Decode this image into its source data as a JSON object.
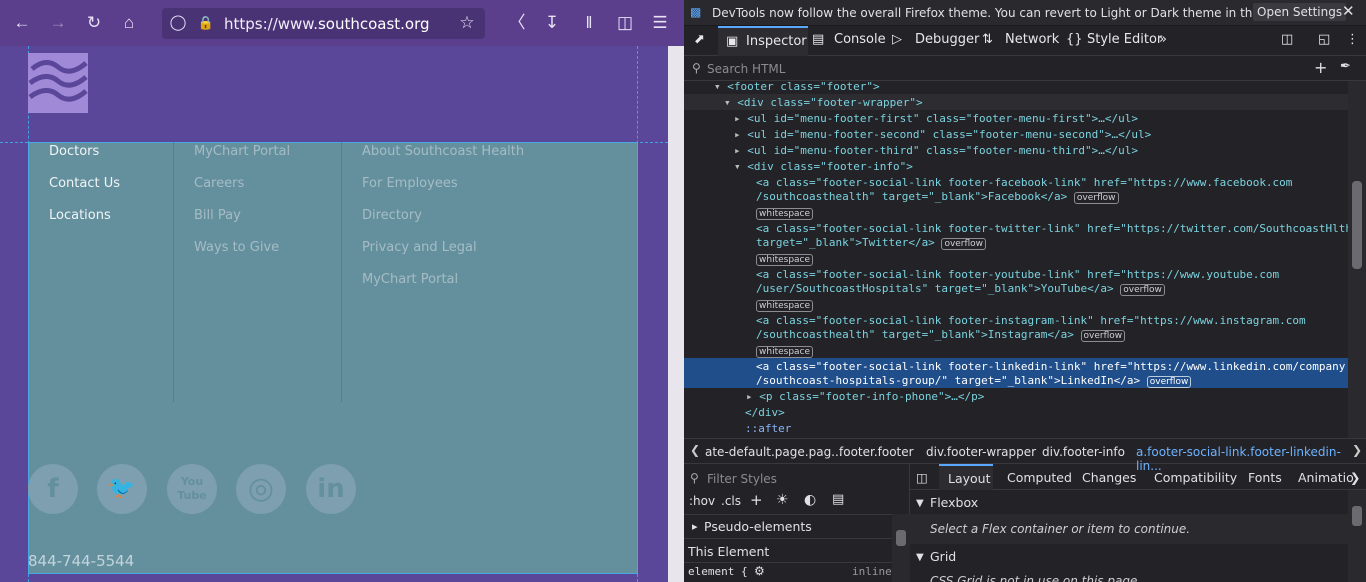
{
  "browser": {
    "url_prefix": "https://www.",
    "url_domain": "southcoast.org",
    "icons": [
      "back-icon",
      "forward-icon",
      "reload-icon",
      "home-icon",
      "shield-icon",
      "lock-icon",
      "star-icon",
      "pocket-icon",
      "download-icon",
      "library-icon",
      "sidebar-icon",
      "menu-icon"
    ]
  },
  "page": {
    "logo_alt": "Southcoast Health",
    "col1": [
      "Doctors",
      "Contact Us",
      "Locations"
    ],
    "col2": [
      "MyChart Portal",
      "Careers",
      "Bill Pay",
      "Ways to Give"
    ],
    "col3": [
      "About Southcoast Health",
      "For Employees",
      "Directory",
      "Privacy and Legal",
      "MyChart Portal"
    ],
    "social": [
      "f",
      "🐦",
      "You Tube",
      "◎",
      "in"
    ],
    "phone": "844-744-5544"
  },
  "devtools": {
    "notice": "DevTools now follow the overall Firefox theme. You can revert to Light or Dark theme in the Settings pa...",
    "notice_button": "Open Settings",
    "tabs": [
      "Inspector",
      "Console",
      "Debugger",
      "Network",
      "Style Editor"
    ],
    "search_placeholder": "Search HTML",
    "html_lines": [
      {
        "t": "<footer class=\"footer\">"
      },
      {
        "t": "<div class=\"footer-wrapper\">"
      },
      {
        "t": "<ul id=\"menu-footer-first\" class=\"footer-menu-first\">…</ul>"
      },
      {
        "t": "<ul id=\"menu-footer-second\" class=\"footer-menu-second\">…</ul>"
      },
      {
        "t": "<ul id=\"menu-footer-third\" class=\"footer-menu-third\">…</ul>"
      },
      {
        "t": "<div class=\"footer-info\">"
      },
      {
        "t": "<a class=\"footer-social-link footer-facebook-link\" href=\"https://www.facebook.com"
      },
      {
        "t": "/southcoasthealth\" target=\"_blank\">Facebook</a>"
      },
      {
        "t": "<a class=\"footer-social-link footer-twitter-link\" href=\"https://twitter.com/SouthcoastHlth/\""
      },
      {
        "t": "target=\"_blank\">Twitter</a>"
      },
      {
        "t": "<a class=\"footer-social-link footer-youtube-link\" href=\"https://www.youtube.com"
      },
      {
        "t": "/user/SouthcoastHospitals\" target=\"_blank\">YouTube</a>"
      },
      {
        "t": "<a class=\"footer-social-link footer-instagram-link\" href=\"https://www.instagram.com"
      },
      {
        "t": "/southcoasthealth\" target=\"_blank\">Instagram</a>"
      },
      {
        "t": "<a class=\"footer-social-link footer-linkedin-link\" href=\"https://www.linkedin.com/company"
      },
      {
        "t": "/southcoast-hospitals-group/\" target=\"_blank\">LinkedIn</a>"
      },
      {
        "t": "<p class=\"footer-info-phone\">…</p>"
      },
      {
        "t": "</div>"
      },
      {
        "t": "::after"
      }
    ],
    "badges": {
      "overflow": "overflow",
      "whitespace": "whitespace"
    },
    "breadcrumb": [
      "ate-default.page.pag...",
      "footer.footer",
      "div.footer-wrapper",
      "div.footer-info",
      "a.footer-social-link.footer-linkedin-lin..."
    ],
    "rules_filter": "Filter Styles",
    "rules_toggles": [
      ":hov",
      ".cls"
    ],
    "pseudo": "Pseudo-elements",
    "this_element": "This Element",
    "element_rule": "element {",
    "inline": "inline",
    "layout_tabs": [
      "Layout",
      "Computed",
      "Changes",
      "Compatibility",
      "Fonts",
      "Animatio"
    ],
    "flexbox": "Flexbox",
    "flex_hint": "Select a Flex container or item to continue.",
    "grid": "Grid",
    "grid_hint": "CSS Grid is not in use on this page"
  }
}
